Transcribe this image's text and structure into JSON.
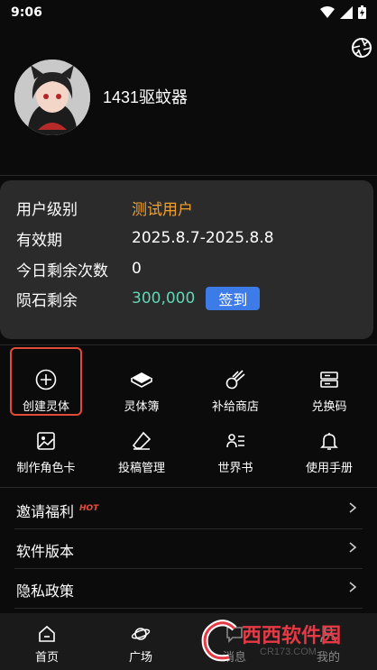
{
  "status_bar": {
    "time": "9:06"
  },
  "profile": {
    "username": "1431驱蚊器"
  },
  "info": {
    "rows": [
      {
        "label": "用户级别",
        "value": "测试用户"
      },
      {
        "label": "有效期",
        "value": "2025.8.7-2025.8.8"
      },
      {
        "label": "今日剩余次数",
        "value": "0"
      },
      {
        "label": "陨石剩余",
        "value": "300,000"
      }
    ],
    "checkin_label": "签到"
  },
  "grid": [
    {
      "label": "创建灵体",
      "icon": "plus-circle-icon"
    },
    {
      "label": "灵体簿",
      "icon": "book-icon"
    },
    {
      "label": "补给商店",
      "icon": "meteor-icon"
    },
    {
      "label": "兑换码",
      "icon": "ticket-icon"
    },
    {
      "label": "制作角色卡",
      "icon": "image-icon"
    },
    {
      "label": "投稿管理",
      "icon": "eraser-icon"
    },
    {
      "label": "世界书",
      "icon": "world-list-icon"
    },
    {
      "label": "使用手册",
      "icon": "bell-icon"
    }
  ],
  "menu": [
    {
      "label": "邀请福利",
      "badge": "HOT"
    },
    {
      "label": "软件版本"
    },
    {
      "label": "隐私政策"
    }
  ],
  "bottom_nav": [
    {
      "label": "首页",
      "icon": "home-icon"
    },
    {
      "label": "广场",
      "icon": "planet-icon"
    },
    {
      "label": "消息",
      "icon": "message-icon"
    },
    {
      "label": "我的",
      "icon": "user-icon"
    }
  ],
  "watermark": {
    "text": "西西软件园",
    "sub": "CR173.COM"
  },
  "colors": {
    "accent": "#3d7be9",
    "orange": "#f0a030",
    "green": "#5fd7b5",
    "highlight": "#e24a3a"
  }
}
